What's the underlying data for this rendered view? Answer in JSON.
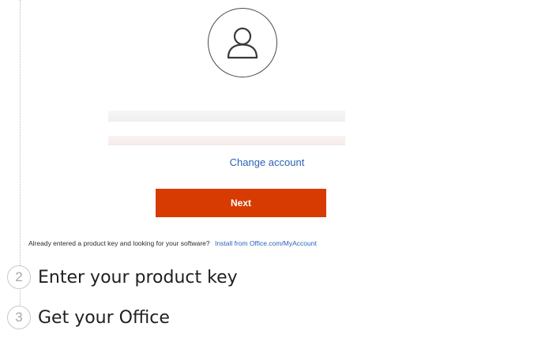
{
  "account": {
    "avatar_icon": "person-icon",
    "change_account_label": "Change account",
    "next_label": "Next"
  },
  "help": {
    "text": "Already entered a product key and looking for your software?",
    "link": "Install from Office.com/MyAccount"
  },
  "steps": [
    {
      "number": "2",
      "title": "Enter your product key"
    },
    {
      "number": "3",
      "title": "Get your Office"
    }
  ],
  "colors": {
    "accent": "#d83b01",
    "link": "#2b63b6"
  }
}
